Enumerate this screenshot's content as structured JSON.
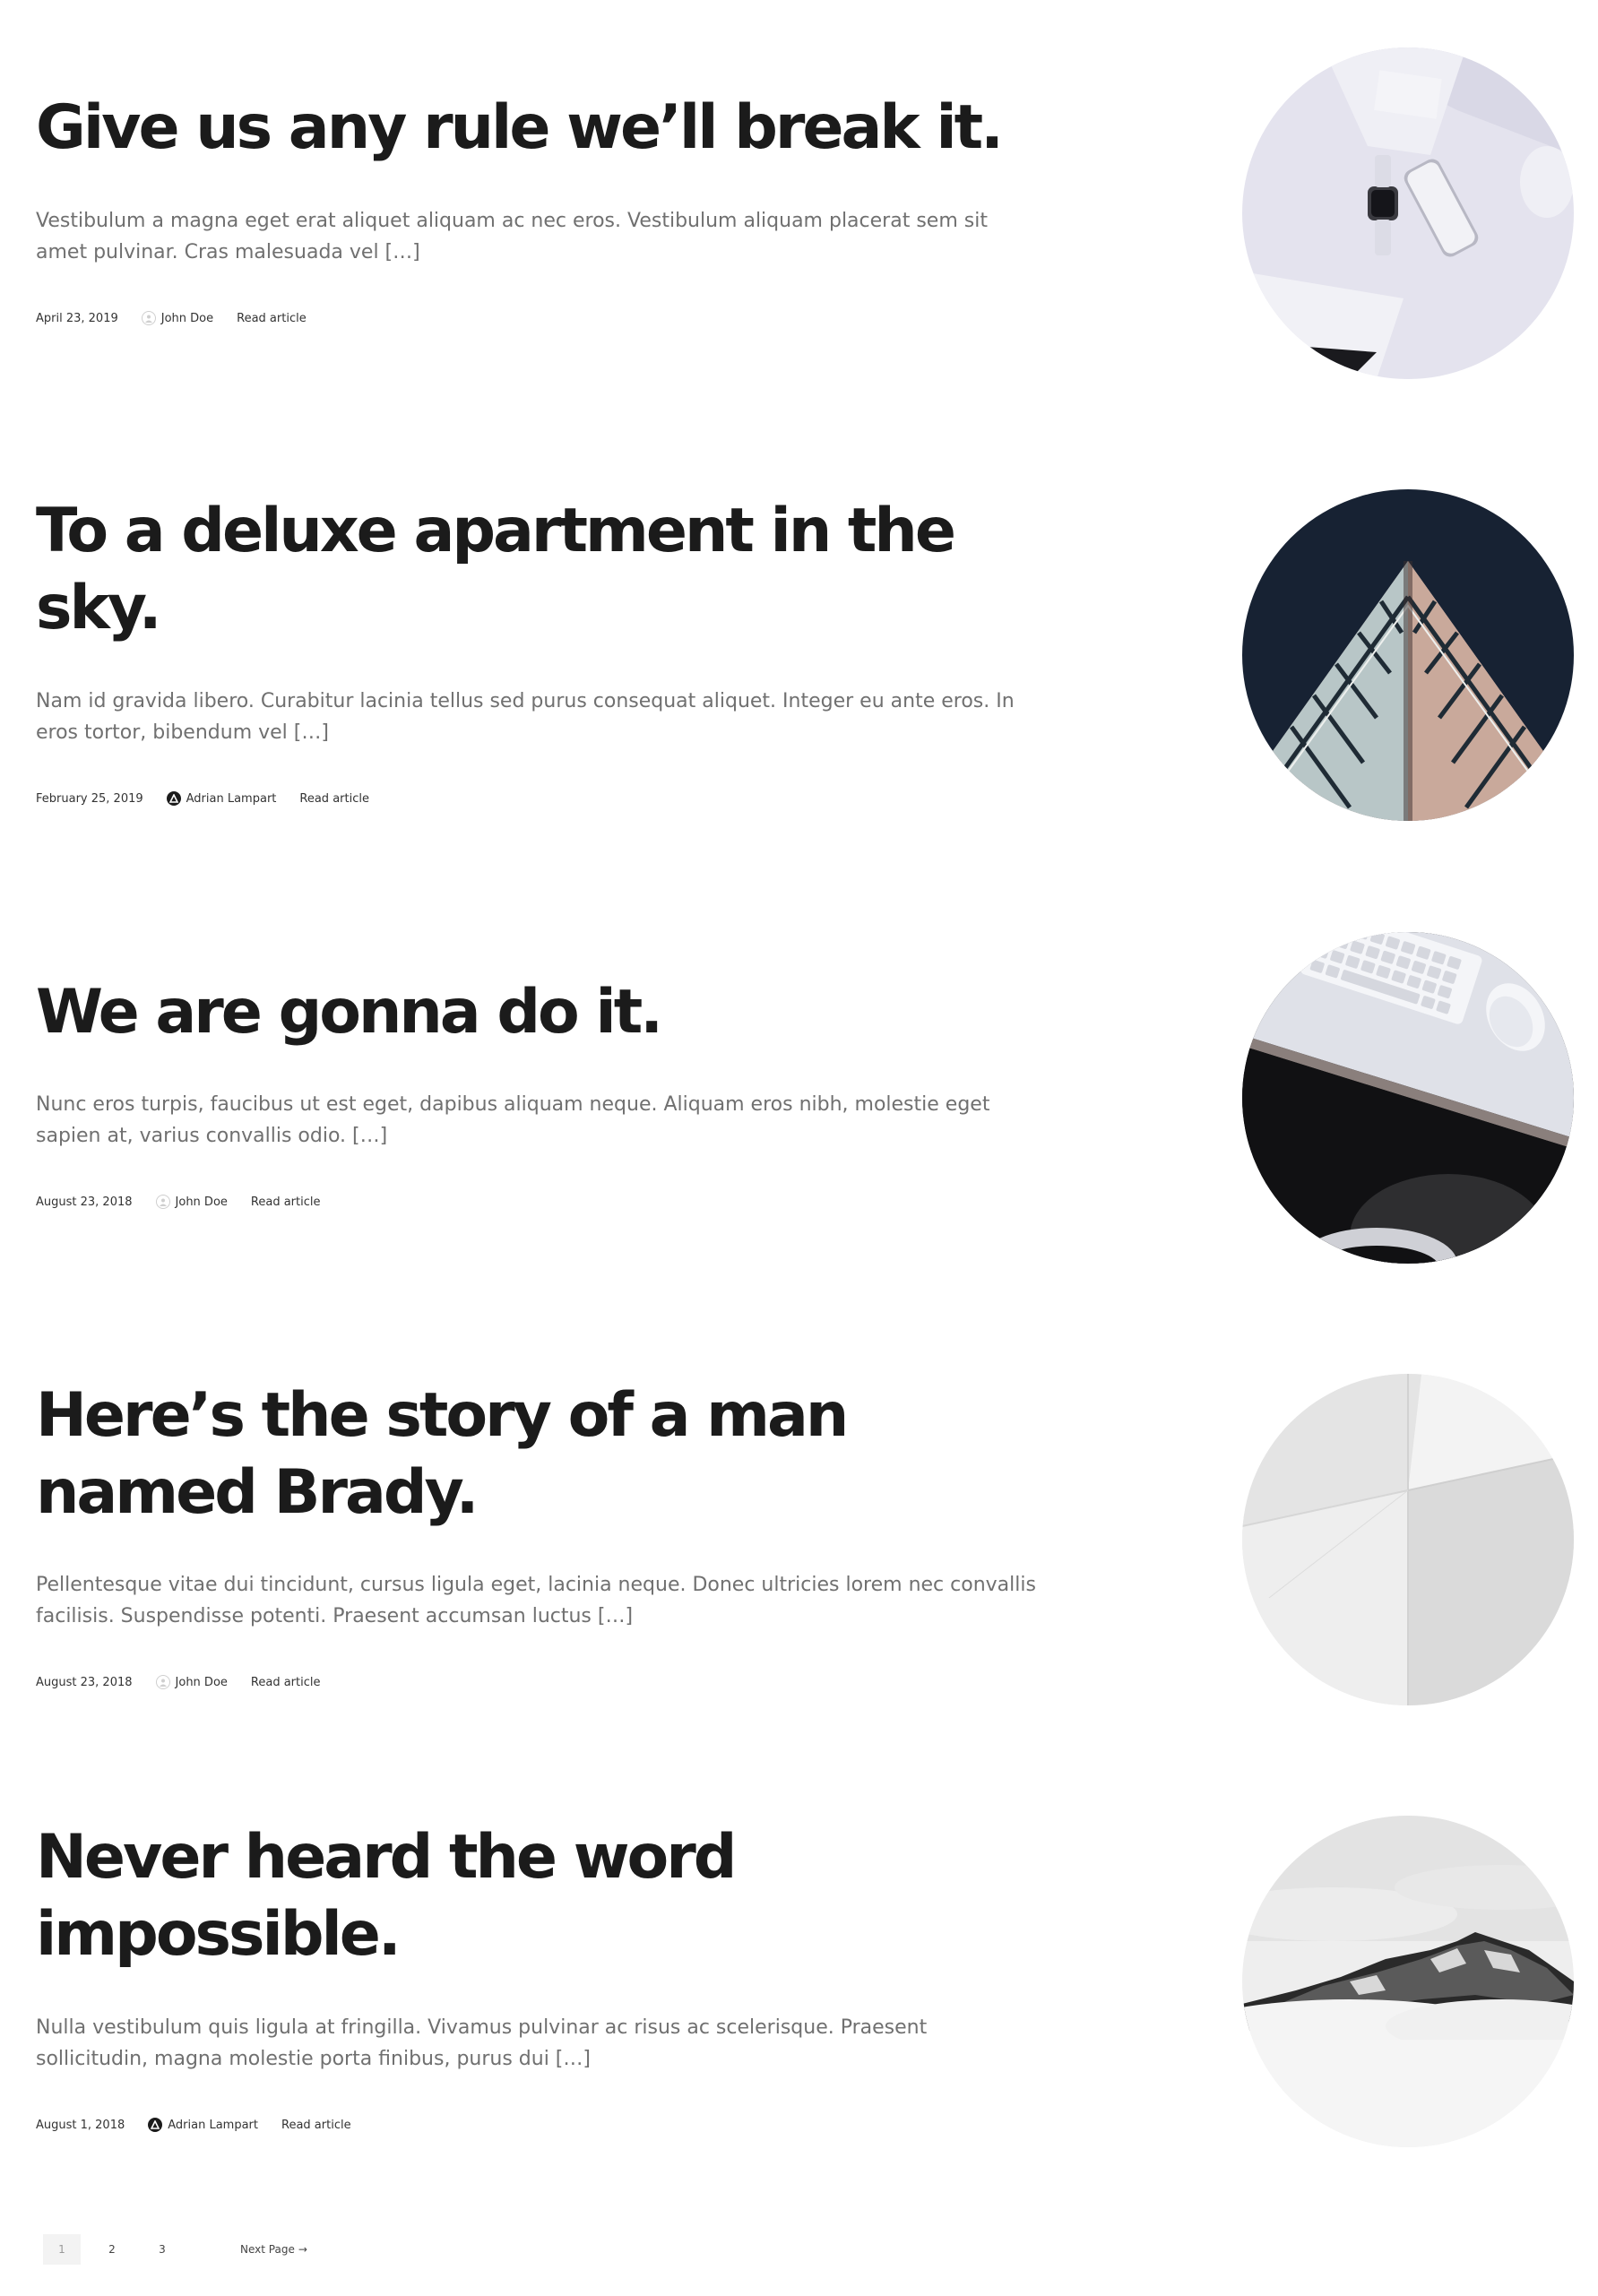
{
  "posts": [
    {
      "title": "Give us any rule we’ll break it.",
      "excerpt": "Vestibulum a magna eget erat aliquet aliquam ac nec eros. Vestibulum aliquam placerat sem sit amet pulvinar. Cras malesuada vel […]",
      "date": "April 23, 2019",
      "author": "John Doe",
      "avatar": "person-avatar-icon",
      "read_label": "Read article",
      "image": "desk-with-phone-and-watch"
    },
    {
      "title": "To a deluxe apartment in the sky.",
      "excerpt": "Nam id gravida libero. Curabitur lacinia tellus sed purus consequat aliquet. Integer eu ante eros. In eros tortor, bibendum vel […]",
      "date": "February 25, 2019",
      "author": "Adrian Lampart",
      "avatar": "logo-avatar-icon",
      "read_label": "Read article",
      "image": "skyscraper-corner-against-dark-sky"
    },
    {
      "title": "We are gonna do it.",
      "excerpt": "Nunc eros turpis, faucibus ut est eget, dapibus aliquam neque. Aliquam eros nibh, molestie eget sapien at, varius convallis odio. […]",
      "date": "August 23, 2018",
      "author": "John Doe",
      "avatar": "person-avatar-icon",
      "read_label": "Read article",
      "image": "desk-with-keyboard-and-mouse"
    },
    {
      "title": "Here’s the story of a man named Brady.",
      "excerpt": "Pellentesque vitae dui tincidunt, cursus ligula eget, lacinia neque. Donec ultricies lorem nec convallis facilisis. Suspendisse potenti. Praesent accumsan luctus […]",
      "date": "August 23, 2018",
      "author": "John Doe",
      "avatar": "person-avatar-icon",
      "read_label": "Read article",
      "image": "white-paper-corner"
    },
    {
      "title": "Never heard the word impossible.",
      "excerpt": "Nulla vestibulum quis ligula at fringilla. Vivamus pulvinar ac risus ac scelerisque. Praesent sollicitudin, magna molestie porta finibus, purus dui […]",
      "date": "August 1, 2018",
      "author": "Adrian Lampart",
      "avatar": "logo-avatar-icon",
      "read_label": "Read article",
      "image": "snowy-mountain-in-clouds"
    }
  ],
  "pagination": {
    "pages": [
      "1",
      "2",
      "3"
    ],
    "current": "1",
    "next_label": "Next Page",
    "next_arrow": "→"
  },
  "colors": {
    "title": "#1b1b1b",
    "excerpt": "#707070",
    "meta": "#333333",
    "current_page_bg": "#f3f3f3"
  }
}
